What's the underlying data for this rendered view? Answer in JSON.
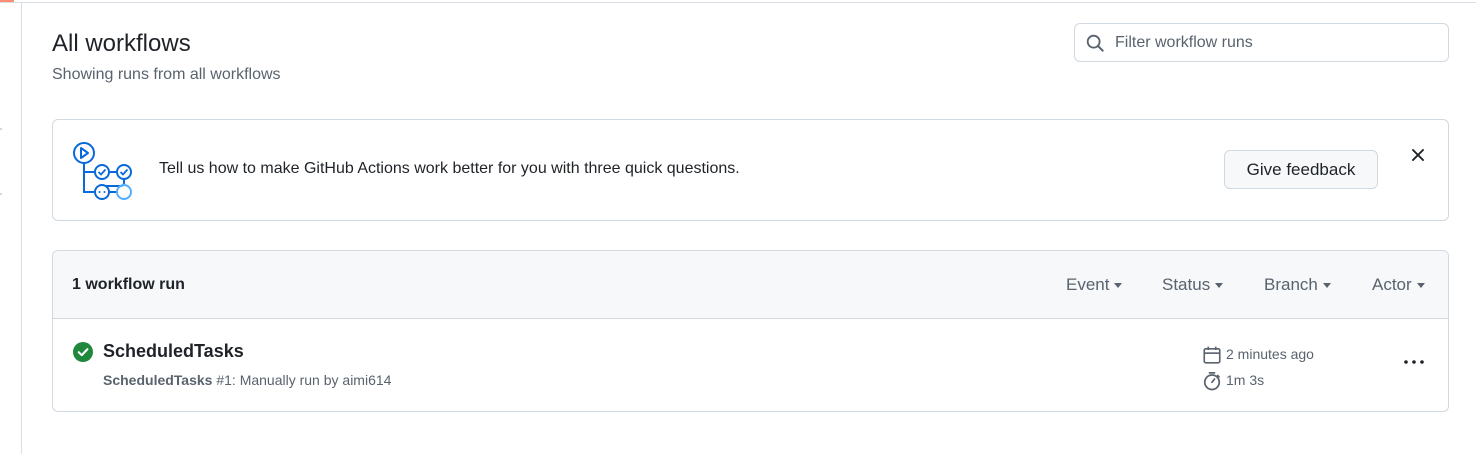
{
  "page": {
    "title": "All workflows",
    "subtitle": "Showing runs from all workflows"
  },
  "search": {
    "placeholder": "Filter workflow runs",
    "value": ""
  },
  "banner": {
    "message": "Tell us how to make GitHub Actions work better for you with three quick questions.",
    "button_label": "Give feedback",
    "close_icon": "x-icon",
    "illustration_icon": "workflow-illustration-icon"
  },
  "runs": {
    "count_label": "1 workflow run",
    "filters": [
      {
        "label": "Event"
      },
      {
        "label": "Status"
      },
      {
        "label": "Branch"
      },
      {
        "label": "Actor"
      }
    ],
    "items": [
      {
        "status": "success",
        "status_icon": "check-circle-fill-icon",
        "title": "ScheduledTasks",
        "workflow_name": "ScheduledTasks",
        "run_detail": "#1: Manually run by aimi614",
        "time_ago": "2 minutes ago",
        "duration": "1m 3s",
        "calendar_icon": "calendar-icon",
        "stopwatch_icon": "stopwatch-icon",
        "more_icon": "kebab-horizontal-icon"
      }
    ]
  },
  "colors": {
    "success": "#1f883d",
    "accent_blue": "#0969da",
    "border": "#d1d9e0",
    "header_bg": "#f6f8fa",
    "muted_text": "#59636e",
    "tab_underline": "#fd8c73"
  }
}
